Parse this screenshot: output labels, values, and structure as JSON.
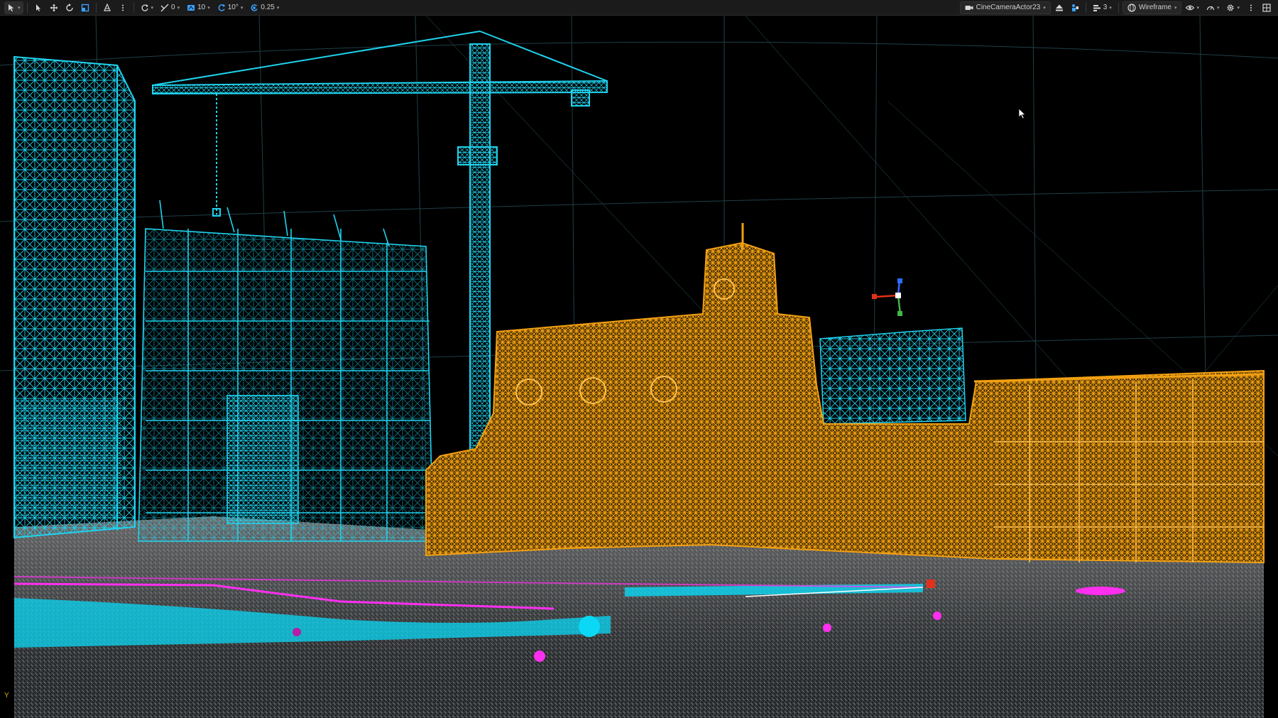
{
  "toolbar": {
    "left": {
      "select_mode_icon": "select-mode-icon",
      "translate_icon": "translate-icon",
      "rotate_icon": "rotate-icon",
      "scale_icon": "scale-icon",
      "transform_space_icon": "world-space-icon",
      "surface_snap_icon": "surface-snap-icon",
      "surface_snap_value": "0",
      "grid_snap_value": "10",
      "rotation_snap_value": "10°",
      "scale_snap_value": "0.25"
    },
    "right": {
      "camera_label": "CineCameraActor23",
      "layers_value": "3",
      "view_mode_label": "Wireframe"
    }
  },
  "viewport": {
    "axis_indicator": "Y",
    "colors": {
      "background": "#000000",
      "grid": "#1f3f48",
      "cyan_wireframe": "#1fd3ef",
      "orange_wireframe": "#f2a012",
      "ground_wireframe": "#7b7b7b",
      "magenta_actor": "#ff2ff0",
      "red_gizmo": "#e2301a",
      "green_gizmo": "#3eb84a",
      "blue_gizmo": "#2f6bff"
    }
  }
}
